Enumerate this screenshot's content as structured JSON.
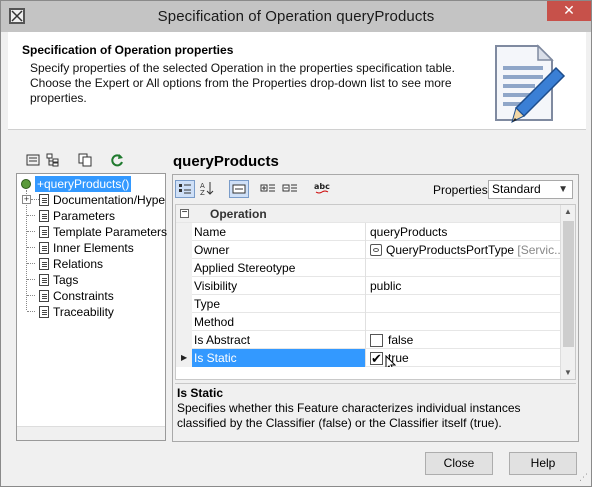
{
  "window": {
    "title": "Specification of Operation queryProducts",
    "close_glyph": "✕"
  },
  "header": {
    "title": "Specification of Operation properties",
    "description": "Specify properties of the selected Operation in the properties specification table. Choose the Expert or All options from the Properties drop-down list to see more properties."
  },
  "tree": {
    "root_label": "+queryProducts()",
    "items": [
      {
        "label": "Documentation/Hyperlinks",
        "expandable": true
      },
      {
        "label": "Parameters"
      },
      {
        "label": "Template Parameters"
      },
      {
        "label": "Inner Elements"
      },
      {
        "label": "Relations"
      },
      {
        "label": "Tags"
      },
      {
        "label": "Constraints"
      },
      {
        "label": "Traceability"
      }
    ]
  },
  "element_name": "queryProducts",
  "properties_toolbar": {
    "label": "Properties:",
    "selected": "Standard"
  },
  "grid": {
    "group": "Operation",
    "rows": [
      {
        "name": "Name",
        "value": "queryProducts"
      },
      {
        "name": "Owner",
        "value": "QueryProductsPortType",
        "value_suffix": "[Servic..."
      },
      {
        "name": "Applied Stereotype",
        "value": ""
      },
      {
        "name": "Visibility",
        "value": "public"
      },
      {
        "name": "Type",
        "value": ""
      },
      {
        "name": "Method",
        "value": ""
      },
      {
        "name": "Is Abstract",
        "value": "false",
        "checkbox": true,
        "checked": false
      },
      {
        "name": "Is Static",
        "value": "true",
        "checkbox": true,
        "checked": true,
        "selected": true
      }
    ]
  },
  "description": {
    "title": "Is Static",
    "text": "Specifies whether this Feature characterizes individual instances classified by the Classifier (false) or the Classifier itself (true)."
  },
  "buttons": {
    "close": "Close",
    "help": "Help"
  },
  "colors": {
    "selection": "#3399ff",
    "close_button": "#c7514a",
    "titlebar": "#c4c4c4"
  }
}
